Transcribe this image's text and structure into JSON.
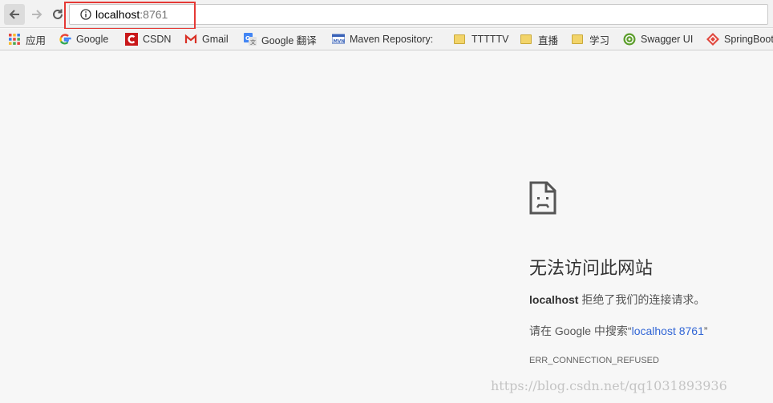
{
  "browser": {
    "url_host": "localhost",
    "url_port": ":8761"
  },
  "bookmarks": [
    {
      "label": "应用",
      "icon": "apps-grid-icon"
    },
    {
      "label": "Google",
      "icon": "google-icon"
    },
    {
      "label": "CSDN",
      "icon": "csdn-icon"
    },
    {
      "label": "Gmail",
      "icon": "gmail-icon"
    },
    {
      "label": "Google 翻译",
      "icon": "google-translate-icon"
    },
    {
      "label": "Maven Repository:",
      "icon": "mvn-icon"
    },
    {
      "label": "TTTTTV",
      "icon": "folder-icon"
    },
    {
      "label": "直播",
      "icon": "folder-icon"
    },
    {
      "label": "学习",
      "icon": "folder-icon"
    },
    {
      "label": "Swagger UI",
      "icon": "swagger-icon"
    },
    {
      "label": "SpringBoot",
      "icon": "springboot-icon"
    }
  ],
  "error": {
    "title": "无法访问此网站",
    "host": "localhost",
    "refused_text": " 拒绝了我们的连接请求。",
    "search_prefix": "请在 Google 中搜索“",
    "search_link": "localhost 8761",
    "search_suffix": "”",
    "code": "ERR_CONNECTION_REFUSED"
  },
  "watermark": "https://blog.csdn.net/qq1031893936",
  "colors": {
    "link": "#3367d6",
    "highlight": "#e53935"
  }
}
